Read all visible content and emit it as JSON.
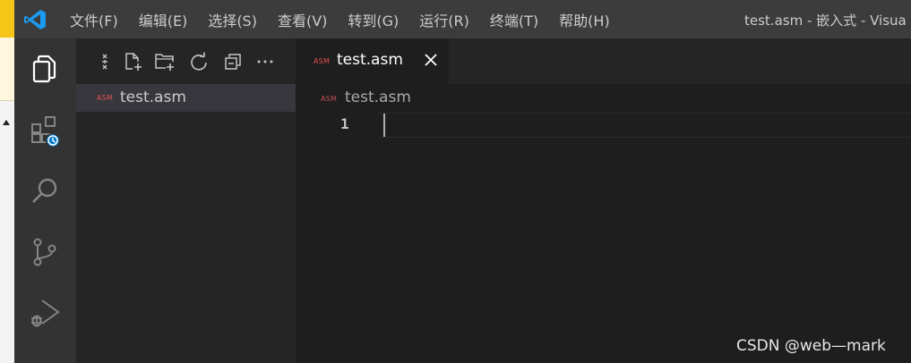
{
  "titlebar": {
    "menu": [
      {
        "label": "文件(F)"
      },
      {
        "label": "编辑(E)"
      },
      {
        "label": "选择(S)"
      },
      {
        "label": "查看(V)"
      },
      {
        "label": "转到(G)"
      },
      {
        "label": "运行(R)"
      },
      {
        "label": "终端(T)"
      },
      {
        "label": "帮助(H)"
      }
    ],
    "window_title": "test.asm - 嵌入式 - Visua"
  },
  "explorer": {
    "files": [
      {
        "badge": "ASM",
        "name": "test.asm"
      }
    ]
  },
  "editor": {
    "tab": {
      "badge": "ASM",
      "label": "test.asm"
    },
    "breadcrumb": {
      "badge": "ASM",
      "label": "test.asm"
    },
    "line_number": "1"
  },
  "watermark": "CSDN @web—mark",
  "colors": {
    "accent": "#007acc",
    "asm_badge": "#e05252",
    "titlebar_bg": "#3c3c3c",
    "activitybar_bg": "#333333",
    "sidebar_bg": "#252526",
    "editor_bg": "#1e1e1e"
  },
  "icons": {
    "logo": "vscode-logo-icon",
    "activity": [
      "explorer-files-icon",
      "extensions-timer-icon",
      "search-icon",
      "source-control-icon",
      "run-debug-icon"
    ],
    "toolbar": [
      "collapse-tree-icon",
      "new-file-icon",
      "new-folder-icon",
      "refresh-icon",
      "collapse-all-icon",
      "more-actions-icon"
    ],
    "tab_close": "close-icon"
  }
}
